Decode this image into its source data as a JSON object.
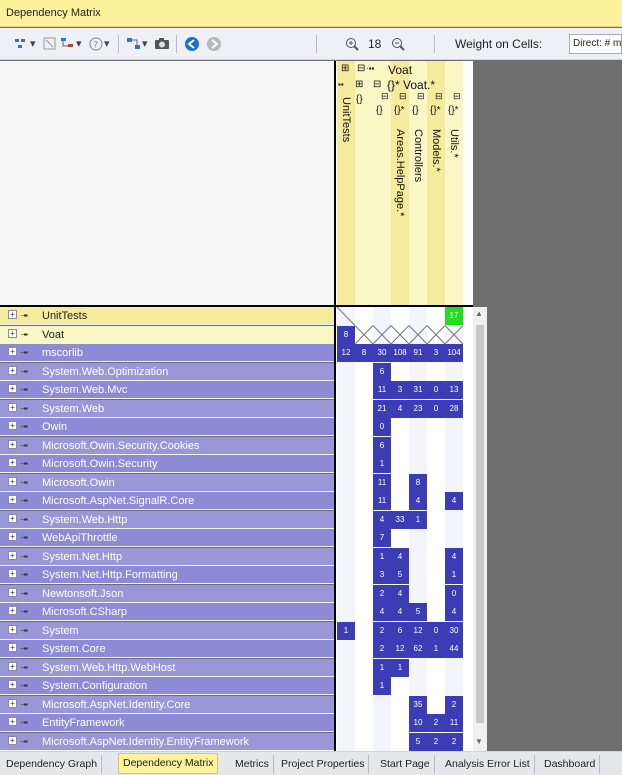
{
  "window": {
    "title": "Dependency Matrix"
  },
  "toolbar": {
    "zoom_value": "18",
    "weight_label": "Weight on Cells:",
    "weight_value": "Direct: # mem"
  },
  "columns": [
    {
      "label": "UnitTests",
      "header_color": "#f4ec9c"
    },
    {
      "label": "Voat",
      "header_color": "#fbf6c6"
    },
    {
      "label": "Voat.*",
      "header_color": "#fbf6c6"
    },
    {
      "label": "Areas.HelpPage.*",
      "header_color": "#f4ec9c"
    },
    {
      "label": "Controllers",
      "header_color": "#fbf6c6"
    },
    {
      "label": "Models.*",
      "header_color": "#f4ec9c"
    },
    {
      "label": "Utils.*",
      "header_color": "#fbf6c6"
    }
  ],
  "column_tree": {
    "root": "Voat",
    "child": "{}* Voat.*",
    "leaf_glyphs": [
      "{}",
      "{}*",
      "{}",
      "{}*",
      "{}*"
    ]
  },
  "rows": [
    {
      "label": "UnitTests",
      "bg": "#f4ec9c",
      "dark": true,
      "cells": [
        "",
        "",
        "",
        "",
        "",
        "",
        "17"
      ]
    },
    {
      "label": "Voat",
      "bg": "#fbf6c6",
      "dark": true,
      "cells": [
        "8",
        "",
        "",
        "",
        "",
        "",
        ""
      ]
    },
    {
      "label": "mscorlib",
      "bg": "#8b8bd6",
      "dark": false,
      "cells": [
        "12",
        "8",
        "30",
        "108",
        "91",
        "3",
        "104"
      ]
    },
    {
      "label": "System.Web.Optimization",
      "bg": "#9898d8",
      "dark": false,
      "cells": [
        "",
        "",
        "6",
        "",
        "",
        "",
        ""
      ]
    },
    {
      "label": "System.Web.Mvc",
      "bg": "#8b8bd6",
      "dark": false,
      "cells": [
        "",
        "",
        "11",
        "3",
        "31",
        "0",
        "13"
      ]
    },
    {
      "label": "System.Web",
      "bg": "#9898d8",
      "dark": false,
      "cells": [
        "",
        "",
        "21",
        "4",
        "23",
        "0",
        "28"
      ]
    },
    {
      "label": "Owin",
      "bg": "#8b8bd6",
      "dark": false,
      "cells": [
        "",
        "",
        "0",
        "",
        "",
        "",
        ""
      ]
    },
    {
      "label": "Microsoft.Owin.Security.Cookies",
      "bg": "#9898d8",
      "dark": false,
      "cells": [
        "",
        "",
        "6",
        "",
        "",
        "",
        ""
      ]
    },
    {
      "label": "Microsoft.Owin.Security",
      "bg": "#8b8bd6",
      "dark": false,
      "cells": [
        "",
        "",
        "1",
        "",
        "",
        "",
        ""
      ]
    },
    {
      "label": "Microsoft.Owin",
      "bg": "#9898d8",
      "dark": false,
      "cells": [
        "",
        "",
        "11",
        "",
        "8",
        "",
        ""
      ]
    },
    {
      "label": "Microsoft.AspNet.SignalR.Core",
      "bg": "#8b8bd6",
      "dark": false,
      "cells": [
        "",
        "",
        "11",
        "",
        "4",
        "",
        "4"
      ]
    },
    {
      "label": "System.Web.Http",
      "bg": "#9898d8",
      "dark": false,
      "cells": [
        "",
        "",
        "4",
        "33",
        "1",
        "",
        ""
      ]
    },
    {
      "label": "WebApiThrottle",
      "bg": "#8b8bd6",
      "dark": false,
      "cells": [
        "",
        "",
        "7",
        "",
        "",
        "",
        ""
      ]
    },
    {
      "label": "System.Net.Http",
      "bg": "#9898d8",
      "dark": false,
      "cells": [
        "",
        "",
        "1",
        "4",
        "",
        "",
        "4"
      ]
    },
    {
      "label": "System.Net.Http.Formatting",
      "bg": "#8b8bd6",
      "dark": false,
      "cells": [
        "",
        "",
        "3",
        "5",
        "",
        "",
        "1"
      ]
    },
    {
      "label": "Newtonsoft.Json",
      "bg": "#9898d8",
      "dark": false,
      "cells": [
        "",
        "",
        "2",
        "4",
        "",
        "",
        "0"
      ]
    },
    {
      "label": "Microsoft.CSharp",
      "bg": "#8b8bd6",
      "dark": false,
      "cells": [
        "",
        "",
        "4",
        "4",
        "5",
        "",
        "4"
      ]
    },
    {
      "label": "System",
      "bg": "#9898d8",
      "dark": false,
      "cells": [
        "1",
        "",
        "2",
        "6",
        "12",
        "0",
        "30"
      ]
    },
    {
      "label": "System.Core",
      "bg": "#8b8bd6",
      "dark": false,
      "cells": [
        "",
        "",
        "2",
        "12",
        "62",
        "1",
        "44"
      ]
    },
    {
      "label": "System.Web.Http.WebHost",
      "bg": "#9898d8",
      "dark": false,
      "cells": [
        "",
        "",
        "1",
        "1",
        "",
        "",
        ""
      ]
    },
    {
      "label": "System.Configuration",
      "bg": "#8b8bd6",
      "dark": false,
      "cells": [
        "",
        "",
        "1",
        "",
        "",
        "",
        ""
      ]
    },
    {
      "label": "Microsoft.AspNet.Identity.Core",
      "bg": "#9898d8",
      "dark": false,
      "cells": [
        "",
        "",
        "",
        "",
        "35",
        "",
        "2"
      ]
    },
    {
      "label": "EntityFramework",
      "bg": "#8b8bd6",
      "dark": false,
      "cells": [
        "",
        "",
        "",
        "",
        "10",
        "2",
        "11"
      ]
    },
    {
      "label": "Microsoft.AspNet.Identity.EntityFramework",
      "bg": "#9898d8",
      "dark": false,
      "cells": [
        "",
        "",
        "",
        "",
        "5",
        "2",
        "2"
      ]
    }
  ],
  "colors": {
    "cell_fill": "#3c3cb4",
    "cell_highlight": "#22dd22",
    "cell_empty_a": "#f4f4fb",
    "cell_empty_b": "#ffffff"
  },
  "tabs": [
    {
      "label": "Dependency Graph",
      "active": false
    },
    {
      "label": "Dependency Matrix",
      "active": true
    },
    {
      "label": "Metrics",
      "active": false
    },
    {
      "label": "Project Properties",
      "active": false
    },
    {
      "label": "Start Page",
      "active": false
    },
    {
      "label": "Analysis Error List",
      "active": false
    },
    {
      "label": "Dashboard",
      "active": false
    }
  ]
}
